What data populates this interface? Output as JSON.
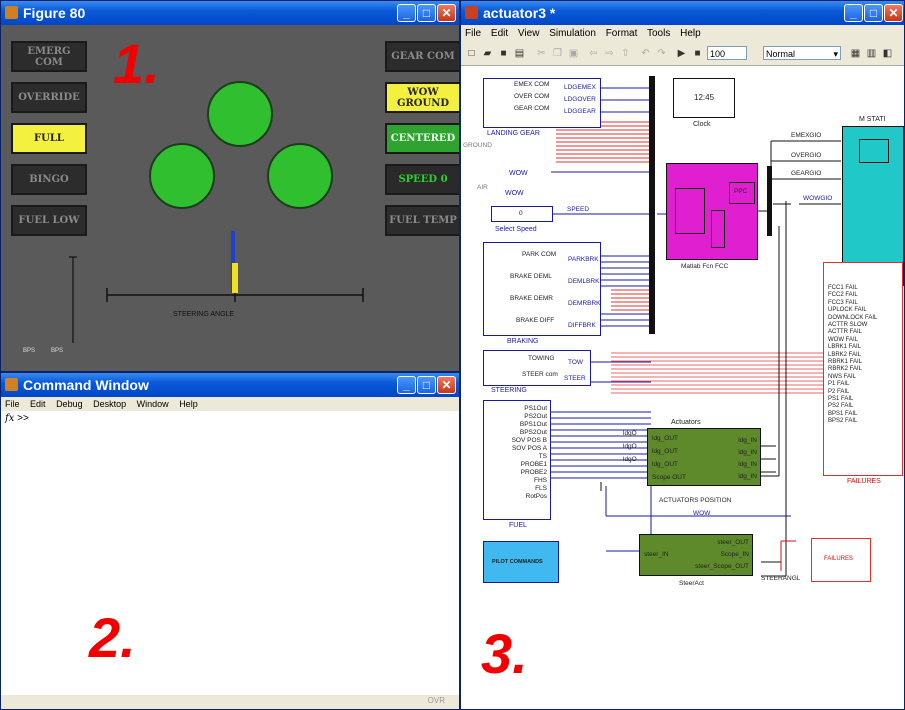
{
  "figure": {
    "title": "Figure 80",
    "big_label": "1.",
    "left_lamps": [
      "EMERG COM",
      "OVERRIDE",
      "FULL",
      "BINGO",
      "FUEL LOW"
    ],
    "right_lamps": [
      "GEAR COM",
      "WOW\nGROUND",
      "CENTERED",
      "SPEED 0",
      "FUEL TEMP"
    ],
    "steering_label": "STEERING ANGLE",
    "small_labels": [
      "BPS",
      "BPS"
    ],
    "colors": {
      "lamp_on_yellow": "#f4f040",
      "lamp_on_green": "#2fa22f",
      "gear_circle": "#2fbf2f",
      "background": "#5a5a5a"
    }
  },
  "command": {
    "title": "Command Window",
    "menu": [
      "File",
      "Edit",
      "Debug",
      "Desktop",
      "Window",
      "Help"
    ],
    "prompt": ">>",
    "fx": "fx",
    "big_label": "2.",
    "status": "OVR"
  },
  "simulink": {
    "title": "actuator3 *",
    "menu": [
      "File",
      "Edit",
      "View",
      "Simulation",
      "Format",
      "Tools",
      "Help"
    ],
    "stop_time": "100",
    "sim_mode": "Normal",
    "big_label": "3.",
    "landing_gear": {
      "inputs": [
        "EMEX COM",
        "OVER COM",
        "GEAR COM"
      ],
      "outputs": [
        "LDGEMEX",
        "LDGOVER",
        "LDGGEAR"
      ],
      "name": "LANDING GEAR"
    },
    "clock": {
      "value": "12:45",
      "name": "Clock"
    },
    "ground": "GROUND",
    "air": "AIR",
    "wow_out": "WOW",
    "wow_name": "WOW",
    "speed": {
      "value": "0",
      "out": "SPEED",
      "name": "Select Speed"
    },
    "fcc": {
      "name": "Matlab Fcn FCC",
      "ppc": "PPC"
    },
    "braking": {
      "inputs": [
        "PARK COM",
        "BRAKE DEML",
        "BRAKE DEMR",
        "BRAKE DIFF"
      ],
      "outputs": [
        "PARKBRK",
        "DEMLBRK",
        "DEMRBRK",
        "DIFFBRK"
      ],
      "name": "BRAKING"
    },
    "steering": {
      "inputs": [
        "TOWING",
        "STEER com"
      ],
      "outputs": [
        "TOW",
        "STEER"
      ],
      "name": "STEERING"
    },
    "fuel": {
      "inputs": [
        "PS1Out",
        "PS2Out",
        "BPS1Out",
        "BPS2Out",
        "SOV POS B",
        "SOV POS A",
        "TS",
        "PROBE1",
        "PROBE2",
        "FHS",
        "FLS",
        "RotPos"
      ],
      "name": "FUEL"
    },
    "actuators": {
      "name": "Actuators",
      "inputs": [
        "ldg_OUT",
        "ldg_OUT",
        "ldg_OUT",
        "Scope OUT"
      ],
      "outputs": [
        "ldg_IN",
        "ldg_IN",
        "ldg_IN",
        "ldg_IN"
      ],
      "left": [
        "ldgO",
        "ldgO",
        "ldgO"
      ],
      "position": "ACTUATORS POSITION",
      "wow": "WOW"
    },
    "steeract": {
      "name": "SteerAct",
      "in": "steer_IN",
      "outputs": [
        "steer_OUT",
        "Scope_IN",
        "steer_Scope_OUT"
      ],
      "out_label": "STEERANGL"
    },
    "pilot": "PILOT COMMANDS",
    "failures_block": "FAILURES",
    "mstati": "M STATI",
    "signals": [
      "EMEXGIO",
      "OVERGIO",
      "GEARGIO",
      "WOWGIO"
    ],
    "failures": {
      "items": [
        "FCC1 FAIL",
        "FCC2 FAIL",
        "FCC3 FAIL",
        "UPLOCK FAIL",
        "DOWNLOCK FAIL",
        "ACTTR SLOW",
        "ACTTR FAIL",
        "WOW FAIL",
        "LBRK1 FAIL",
        "LBRK2 FAIL",
        "RBRK1 FAIL",
        "RBRK2 FAIL",
        "NWS FAIL",
        "P1 FAIL",
        "P2 FAIL",
        "PS1 FAIL",
        "PS2 FAIL",
        "BPS1 FAIL",
        "BPS2 FAIL"
      ],
      "name": "FAILURES"
    }
  }
}
